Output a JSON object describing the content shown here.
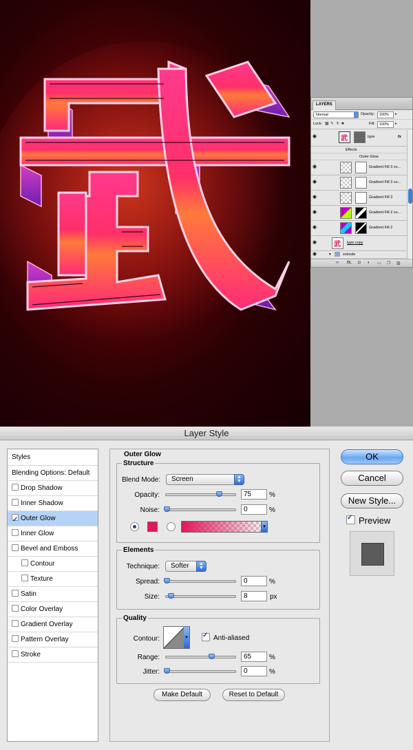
{
  "layers_panel": {
    "tab": "LAYERS",
    "blend_mode": "Normal",
    "opacity_label": "Opacity:",
    "opacity": "100%",
    "lock_label": "Lock:",
    "fill_label": "Fill:",
    "fill": "100%",
    "layers": [
      {
        "name": "type"
      },
      {
        "name": "Effects"
      },
      {
        "name": "Outer Glow"
      },
      {
        "name": "Gradient Fill 3 co..."
      },
      {
        "name": "Gradient Fill 3 co..."
      },
      {
        "name": "Gradient Fill 3"
      },
      {
        "name": "Gradient Fill 2 co..."
      },
      {
        "name": "Gradient Fill 2"
      },
      {
        "name": "type copy"
      },
      {
        "name": "extrude"
      }
    ],
    "footer_icons": [
      "link-icon",
      "fx-icon",
      "mask-icon",
      "adjustment-icon",
      "folder-icon",
      "new-layer-icon",
      "trash-icon"
    ]
  },
  "dialog": {
    "title": "Layer Style",
    "styles": [
      {
        "label": "Styles",
        "type": "header"
      },
      {
        "label": "Blending Options: Default",
        "type": "header"
      },
      {
        "label": "Drop Shadow",
        "checked": false
      },
      {
        "label": "Inner Shadow",
        "checked": false
      },
      {
        "label": "Outer Glow",
        "checked": true,
        "selected": true
      },
      {
        "label": "Inner Glow",
        "checked": false
      },
      {
        "label": "Bevel and Emboss",
        "checked": false
      },
      {
        "label": "Contour",
        "checked": false,
        "indent": true
      },
      {
        "label": "Texture",
        "checked": false,
        "indent": true
      },
      {
        "label": "Satin",
        "checked": false
      },
      {
        "label": "Color Overlay",
        "checked": false
      },
      {
        "label": "Gradient Overlay",
        "checked": false
      },
      {
        "label": "Pattern Overlay",
        "checked": false
      },
      {
        "label": "Stroke",
        "checked": false
      }
    ],
    "outer_glow": {
      "title": "Outer Glow",
      "structure": {
        "title": "Structure",
        "blend_mode_label": "Blend Mode:",
        "blend_mode": "Screen",
        "opacity_label": "Opacity:",
        "opacity": "75",
        "opacity_unit": "%",
        "noise_label": "Noise:",
        "noise": "0",
        "noise_unit": "%",
        "color": "#e0175a"
      },
      "elements": {
        "title": "Elements",
        "technique_label": "Technique:",
        "technique": "Softer",
        "spread_label": "Spread:",
        "spread": "0",
        "spread_unit": "%",
        "size_label": "Size:",
        "size": "8",
        "size_unit": "px"
      },
      "quality": {
        "title": "Quality",
        "contour_label": "Contour:",
        "anti_aliased_label": "Anti-aliased",
        "range_label": "Range:",
        "range": "65",
        "range_unit": "%",
        "jitter_label": "Jitter:",
        "jitter": "0",
        "jitter_unit": "%"
      },
      "make_default": "Make Default",
      "reset_default": "Reset to Default"
    },
    "buttons": {
      "ok": "OK",
      "cancel": "Cancel",
      "new_style": "New Style...",
      "preview": "Preview"
    }
  }
}
